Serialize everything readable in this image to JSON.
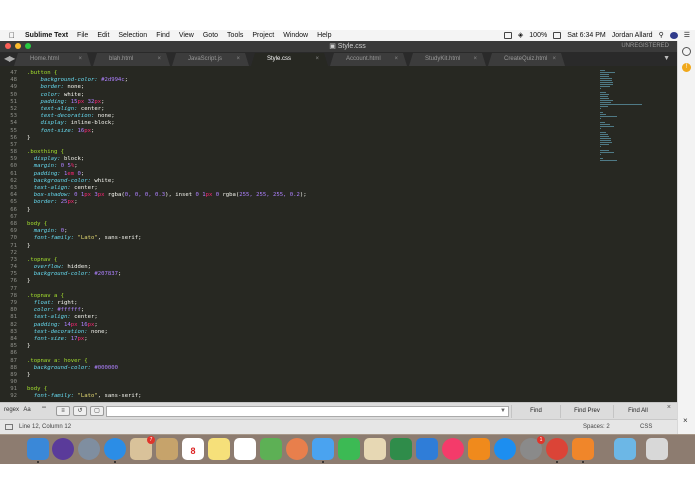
{
  "menubar": {
    "app_name": "Sublime Text",
    "items": [
      "File",
      "Edit",
      "Selection",
      "Find",
      "View",
      "Goto",
      "Tools",
      "Project",
      "Window",
      "Help"
    ],
    "battery": "100%",
    "clock": "Sat 6:34 PM",
    "user": "Jordan Allard"
  },
  "window": {
    "title": "Style.css",
    "unregistered": "UNREGISTERED"
  },
  "tabs": [
    {
      "label": "Home.html"
    },
    {
      "label": "blah.html"
    },
    {
      "label": "JavaScript.js"
    },
    {
      "label": "Style.css"
    },
    {
      "label": "Account.html"
    },
    {
      "label": "StudyKit.html"
    },
    {
      "label": "CreateQuiz.html"
    }
  ],
  "active_tab": 3,
  "editor": {
    "line_numbers": [
      "47",
      "48",
      "49",
      "50",
      "51",
      "52",
      "53",
      "54",
      "55",
      "56",
      "57",
      "58",
      "59",
      "60",
      "61",
      "62",
      "63",
      "64",
      "65",
      "66",
      "67",
      "68",
      "69",
      "70",
      "71",
      "72",
      "73",
      "74",
      "75",
      "76",
      "77",
      "78",
      "79",
      "80",
      "81",
      "82",
      "83",
      "84",
      "85",
      "86",
      "87",
      "88",
      "89",
      "90",
      "91",
      "92"
    ],
    "code_lines": [
      [
        {
          "t": ".button {",
          "c": "sel"
        }
      ],
      [
        {
          "t": "    background-color: ",
          "c": "prop"
        },
        {
          "t": "#2d994c",
          "c": "num"
        },
        {
          "t": ";",
          "c": ""
        }
      ],
      [
        {
          "t": "    border: ",
          "c": "prop"
        },
        {
          "t": "none;",
          "c": ""
        }
      ],
      [
        {
          "t": "    color: ",
          "c": "prop"
        },
        {
          "t": "white;",
          "c": ""
        }
      ],
      [
        {
          "t": "    padding: ",
          "c": "prop"
        },
        {
          "t": "15",
          "c": "num"
        },
        {
          "t": "px ",
          "c": "unit"
        },
        {
          "t": "32",
          "c": "num"
        },
        {
          "t": "px",
          "c": "unit"
        },
        {
          "t": ";",
          "c": ""
        }
      ],
      [
        {
          "t": "    text-align: ",
          "c": "prop"
        },
        {
          "t": "center;",
          "c": ""
        }
      ],
      [
        {
          "t": "    text-decoration: ",
          "c": "prop"
        },
        {
          "t": "none;",
          "c": ""
        }
      ],
      [
        {
          "t": "    display: ",
          "c": "prop"
        },
        {
          "t": "inline-block;",
          "c": ""
        }
      ],
      [
        {
          "t": "    font-size: ",
          "c": "prop"
        },
        {
          "t": "16",
          "c": "num"
        },
        {
          "t": "px",
          "c": "unit"
        },
        {
          "t": ";",
          "c": ""
        }
      ],
      [
        {
          "t": "}",
          "c": ""
        }
      ],
      [
        {
          "t": "",
          "c": ""
        }
      ],
      [
        {
          "t": ".boxthing {",
          "c": "sel"
        }
      ],
      [
        {
          "t": "  display: ",
          "c": "prop"
        },
        {
          "t": "block;",
          "c": ""
        }
      ],
      [
        {
          "t": "  margin: ",
          "c": "prop"
        },
        {
          "t": "0 ",
          "c": "num"
        },
        {
          "t": "5",
          "c": "num"
        },
        {
          "t": "%",
          "c": "unit"
        },
        {
          "t": ";",
          "c": ""
        }
      ],
      [
        {
          "t": "  padding: ",
          "c": "prop"
        },
        {
          "t": "1",
          "c": "num"
        },
        {
          "t": "em ",
          "c": "unit"
        },
        {
          "t": "0",
          "c": "num"
        },
        {
          "t": ";",
          "c": ""
        }
      ],
      [
        {
          "t": "  background-color: ",
          "c": "prop"
        },
        {
          "t": "white;",
          "c": ""
        }
      ],
      [
        {
          "t": "  text-align: ",
          "c": "prop"
        },
        {
          "t": "center;",
          "c": ""
        }
      ],
      [
        {
          "t": "  box-shadow: ",
          "c": "prop"
        },
        {
          "t": "0 ",
          "c": "num"
        },
        {
          "t": "1",
          "c": "num"
        },
        {
          "t": "px ",
          "c": "unit"
        },
        {
          "t": "3",
          "c": "num"
        },
        {
          "t": "px ",
          "c": "unit"
        },
        {
          "t": "rgba(",
          "c": ""
        },
        {
          "t": "0, 0, 0, 0.3",
          "c": "num"
        },
        {
          "t": "), inset ",
          "c": ""
        },
        {
          "t": "0 ",
          "c": "num"
        },
        {
          "t": "1",
          "c": "num"
        },
        {
          "t": "px ",
          "c": "unit"
        },
        {
          "t": "0 ",
          "c": "num"
        },
        {
          "t": "rgba(",
          "c": ""
        },
        {
          "t": "255, 255, 255, 0.2",
          "c": "num"
        },
        {
          "t": ");",
          "c": ""
        }
      ],
      [
        {
          "t": "  border: ",
          "c": "prop"
        },
        {
          "t": "25",
          "c": "num"
        },
        {
          "t": "px",
          "c": "unit"
        },
        {
          "t": ";",
          "c": ""
        }
      ],
      [
        {
          "t": "}",
          "c": ""
        }
      ],
      [
        {
          "t": "",
          "c": ""
        }
      ],
      [
        {
          "t": "body {",
          "c": "sel"
        }
      ],
      [
        {
          "t": "  margin: ",
          "c": "prop"
        },
        {
          "t": "0",
          "c": "num"
        },
        {
          "t": ";",
          "c": ""
        }
      ],
      [
        {
          "t": "  font-family: ",
          "c": "prop"
        },
        {
          "t": "\"Lato\"",
          "c": "str"
        },
        {
          "t": ", sans-serif;",
          "c": ""
        }
      ],
      [
        {
          "t": "}",
          "c": ""
        }
      ],
      [
        {
          "t": "",
          "c": ""
        }
      ],
      [
        {
          "t": ".topnav {",
          "c": "sel"
        }
      ],
      [
        {
          "t": "  overflow: ",
          "c": "prop"
        },
        {
          "t": "hidden;",
          "c": ""
        }
      ],
      [
        {
          "t": "  background-color: ",
          "c": "prop"
        },
        {
          "t": "#207837",
          "c": "num"
        },
        {
          "t": ";",
          "c": ""
        }
      ],
      [
        {
          "t": "}",
          "c": ""
        }
      ],
      [
        {
          "t": "",
          "c": ""
        }
      ],
      [
        {
          "t": ".topnav a {",
          "c": "sel"
        }
      ],
      [
        {
          "t": "  float: ",
          "c": "prop"
        },
        {
          "t": "right;",
          "c": ""
        }
      ],
      [
        {
          "t": "  color: ",
          "c": "prop"
        },
        {
          "t": "#ffffff",
          "c": "num"
        },
        {
          "t": ";",
          "c": ""
        }
      ],
      [
        {
          "t": "  text-align: ",
          "c": "prop"
        },
        {
          "t": "center;",
          "c": ""
        }
      ],
      [
        {
          "t": "  padding: ",
          "c": "prop"
        },
        {
          "t": "14",
          "c": "num"
        },
        {
          "t": "px ",
          "c": "unit"
        },
        {
          "t": "16",
          "c": "num"
        },
        {
          "t": "px",
          "c": "unit"
        },
        {
          "t": ";",
          "c": ""
        }
      ],
      [
        {
          "t": "  text-decoration: ",
          "c": "prop"
        },
        {
          "t": "none;",
          "c": ""
        }
      ],
      [
        {
          "t": "  font-size: ",
          "c": "prop"
        },
        {
          "t": "17",
          "c": "num"
        },
        {
          "t": "px",
          "c": "unit"
        },
        {
          "t": ";",
          "c": ""
        }
      ],
      [
        {
          "t": "}",
          "c": ""
        }
      ],
      [
        {
          "t": "",
          "c": ""
        }
      ],
      [
        {
          "t": ".topnav a: hover {",
          "c": "sel"
        }
      ],
      [
        {
          "t": "  background-color: ",
          "c": "prop"
        },
        {
          "t": "#000000",
          "c": "num"
        }
      ],
      [
        {
          "t": "}",
          "c": ""
        }
      ],
      [
        {
          "t": "",
          "c": ""
        }
      ],
      [
        {
          "t": "body {",
          "c": "sel"
        }
      ],
      [
        {
          "t": "  font-family: ",
          "c": "prop"
        },
        {
          "t": "\"Lato\"",
          "c": "str"
        },
        {
          "t": ", sans-serif;",
          "c": ""
        }
      ]
    ]
  },
  "find_panel": {
    "options": [
      "regex",
      "Aa",
      "\"\"",
      "in-selection",
      "wrap",
      "highlight"
    ],
    "input_value": "",
    "find_label": "Find",
    "find_prev_label": "Find Prev",
    "find_all_label": "Find All",
    "close_label": "×"
  },
  "statusbar": {
    "position": "Line 12, Column 12",
    "spaces": "Spaces: 2",
    "syntax": "CSS"
  },
  "dock": {
    "calendar_day": "8",
    "badges": [
      "7",
      "1"
    ]
  },
  "colors": {
    "editor_bg": "#272822",
    "selector": "#a6e22e",
    "property": "#66d9ef",
    "number": "#ae81ff",
    "unit": "#f92672",
    "string": "#e6db74"
  }
}
